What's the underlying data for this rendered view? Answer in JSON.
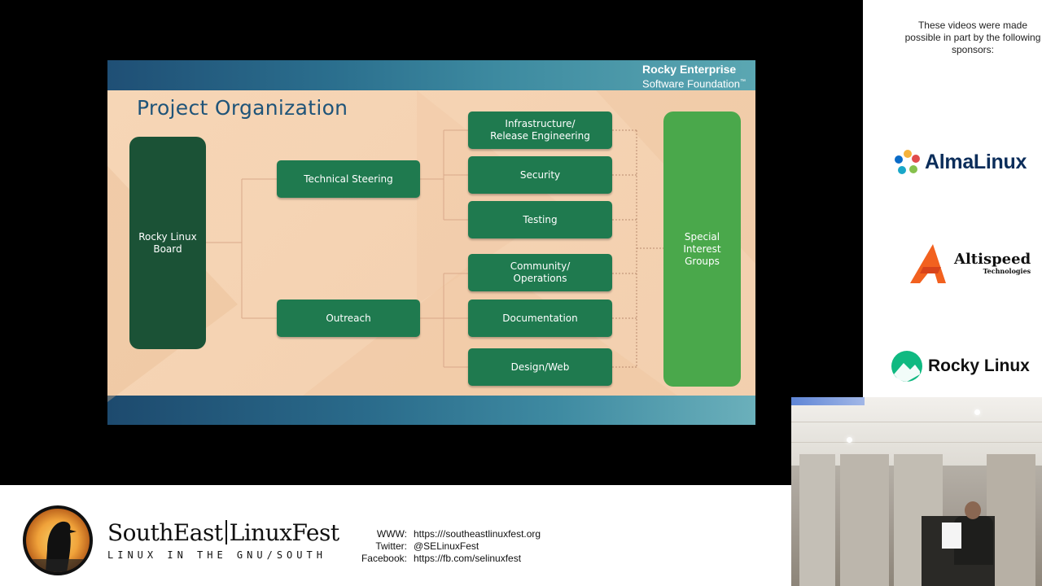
{
  "slide": {
    "brand_line1": "Rocky Enterprise",
    "brand_line2": "Software Foundation",
    "brand_tm": "™",
    "title": "Project Organization",
    "board": "Rocky Linux\nBoard",
    "technical_steering": "Technical Steering",
    "outreach": "Outreach",
    "infrastructure": "Infrastructure/\nRelease Engineering",
    "security": "Security",
    "testing": "Testing",
    "community": "Community/\nOperations",
    "documentation": "Documentation",
    "design_web": "Design/Web",
    "special_interest": "Special\nInterest\nGroups"
  },
  "sponsors": {
    "intro": "These videos were made possible in part by the following sponsors:",
    "alma": "AlmaLinux",
    "altispeed": "Altispeed",
    "altispeed_sub": "Technologies",
    "rocky": "Rocky Linux"
  },
  "footer": {
    "name_left": "SouthEast",
    "name_right": "LinuxFest",
    "tagline": "LINUX IN THE GNU/SOUTH",
    "www_label": "WWW:",
    "twitter_label": "Twitter:",
    "facebook_label": "Facebook:",
    "www_value": "https:///southeastlinuxfest.org",
    "twitter_value": "@SELinuxFest",
    "facebook_value": "https://fb.com/selinuxfest"
  },
  "colors": {
    "board": "#1b5236",
    "node": "#1f7a4f",
    "sig": "#4aa84b",
    "title": "#1f5479"
  }
}
